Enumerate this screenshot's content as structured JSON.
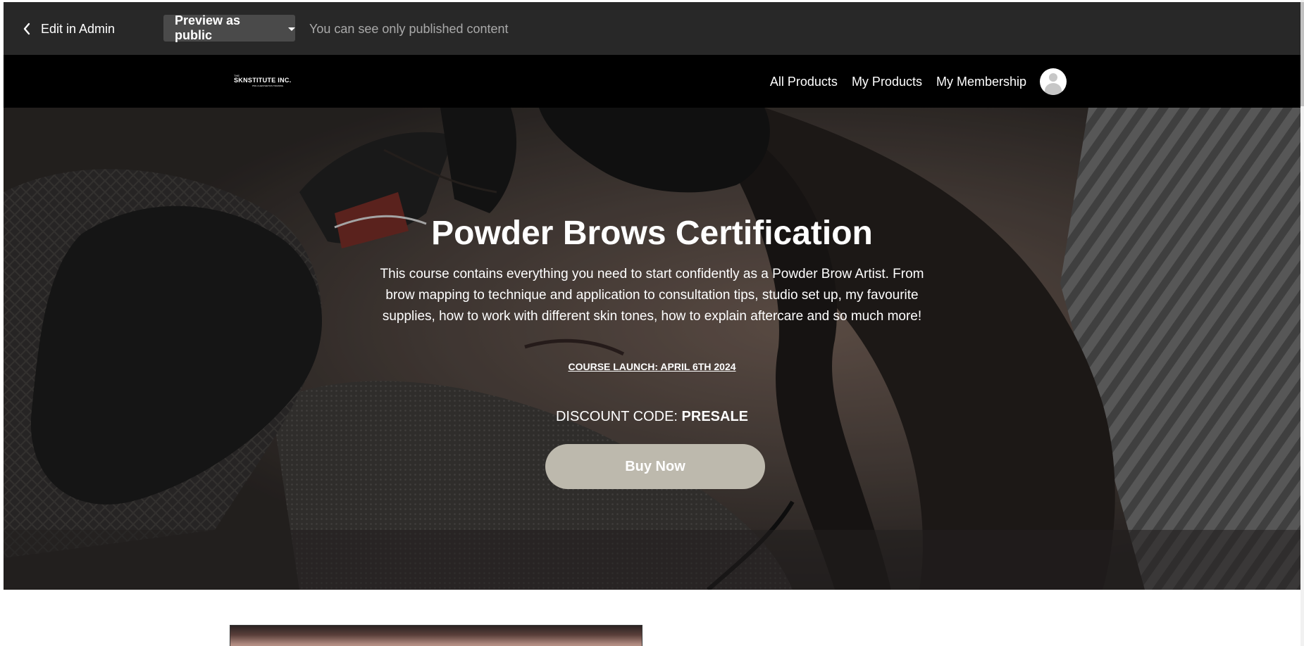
{
  "admin_bar": {
    "back_label": "Edit in Admin",
    "preview_label": "Preview as public",
    "note": "You can see only published content"
  },
  "nav": {
    "logo": {
      "small": "THE",
      "main": "SKNSTITUTE INC.",
      "sub": "PMU & AESTHETICS TRAINING"
    },
    "links": [
      "All Products",
      "My Products",
      "My Membership"
    ]
  },
  "hero": {
    "title": "Powder Brows Certification",
    "description": "This course contains everything you need to start confidently as a Powder Brow Artist. From brow mapping to technique and application to consultation tips, studio set up, my favourite supplies, how to work with different skin tones, how to explain aftercare and so much more!",
    "launch_note": "COURSE LAUNCH: APRIL 6TH 2024",
    "discount_label": "DISCOUNT CODE: ",
    "discount_code": "PRESALE",
    "button_label": "Buy Now"
  },
  "colors": {
    "admin_bar_bg": "#282828",
    "nav_bg": "#000000",
    "button_bg": "#bdb9ad",
    "admin_note": "#a9a9a9"
  },
  "icons": {
    "back": "chevron-left-icon",
    "dropdown": "caret-down-icon",
    "avatar": "user-avatar-icon"
  }
}
